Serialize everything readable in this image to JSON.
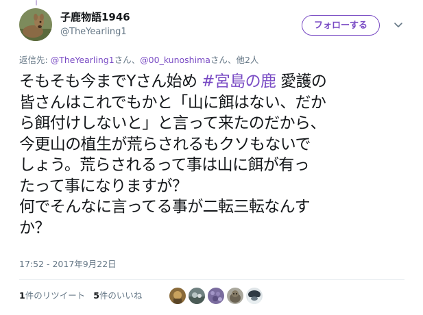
{
  "author": {
    "display_name": "子鹿物語1946",
    "screen_name": "@TheYearling1"
  },
  "follow_button_label": "フォローする",
  "reply_context": {
    "prefix": "返信先: ",
    "mention_1": "@TheYearling1",
    "sep_1": "さん、",
    "mention_2": "@00_kunoshima",
    "sep_2": "さん、",
    "others": "他2人"
  },
  "tweet": {
    "line_1_a": "そもそも今までYさん始め ",
    "hashtag": "#宮島の鹿",
    "line_1_b": " 愛護の",
    "line_2": "皆さんはこれでもかと「山に餌はない、だか",
    "line_3": "ら餌付けしないと」と言って来たのだから、",
    "line_4": "今更山の植生が荒らされるもクソもないで",
    "line_5": "しょう。荒らされるって事は山に餌が有っ",
    "line_6": "たって事になりますが？",
    "line_7": "何でそんなに言ってる事が二転三転なんす",
    "line_8": "か？"
  },
  "timestamp": "17:52 - 2017年9月22日",
  "stats": {
    "retweet_count": "1",
    "retweet_label": "件のリツイート",
    "like_count": "5",
    "like_label": "件のいいね"
  },
  "colors": {
    "accent": "#794bc4",
    "secondary_text": "#657786",
    "primary_text": "#14171a",
    "divider": "#e6ecf0"
  },
  "icons": {
    "more": "chevron-down-icon"
  }
}
